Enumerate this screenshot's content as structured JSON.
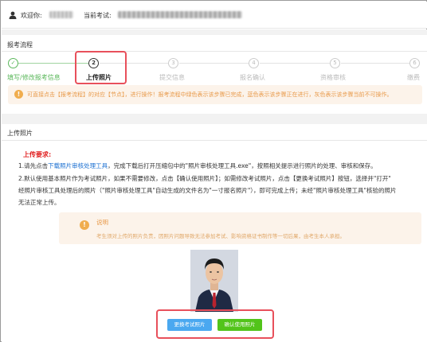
{
  "header": {
    "welcome_label": "欢迎你:",
    "current_exam_label": "当前考试:"
  },
  "process": {
    "title": "报考流程",
    "steps": [
      {
        "num": "✓",
        "label": "填写/修改报考信息",
        "state": "done"
      },
      {
        "num": "2",
        "label": "上传照片",
        "state": "active"
      },
      {
        "num": "3",
        "label": "提交信息",
        "state": "pending"
      },
      {
        "num": "4",
        "label": "报名确认",
        "state": "pending"
      },
      {
        "num": "5",
        "label": "资格审核",
        "state": "pending"
      },
      {
        "num": "6",
        "label": "缴费",
        "state": "pending"
      }
    ],
    "notice": "可直接点击【报考流程】的对应【节点】，进行操作！报考流程中绿色表示该步骤已完成，蓝色表示该步骤正在进行，灰色表示该步骤当前不可操作。"
  },
  "upload": {
    "title": "上传照片",
    "requirements_title": "上传要求:",
    "line1_pre": "1.请先点击",
    "line1_link": "下载照片审核处理工具",
    "line1_post": "，完成下载后打开压缩包中的\"照片审核处理工具.exe\"，按照相关提示进行照片的处理、审核和保存。",
    "line2": "2.默认使用基本照片作为考试照片，如果不需要修改，点击【确认使用照片】；如需修改考试照片，点击【更换考试照片】按钮，选择并\"打开\"",
    "line3": "经照片审核工具处理后的照片（\"照片审核处理工具\"自动生成的文件名为\"一寸报名照片\"），即可完成上传；未经\"照片审核处理工具\"核验的照片",
    "line4": "无法正常上传。",
    "notice_title": "说明",
    "notice_text": "考生须对上传的照片负责，因照片问题导致无法参加考试、影响资格证书制作等一切后果，由考生本人承担。",
    "change_photo_button": "更换考试照片",
    "confirm_photo_button": "确认使用照片"
  },
  "colors": {
    "done": "#5cb85c",
    "highlight": "#e8505b",
    "warning": "#f0ad4e",
    "primary": "#4aa8f0",
    "confirm": "#52c41a",
    "required": "#e02020"
  }
}
